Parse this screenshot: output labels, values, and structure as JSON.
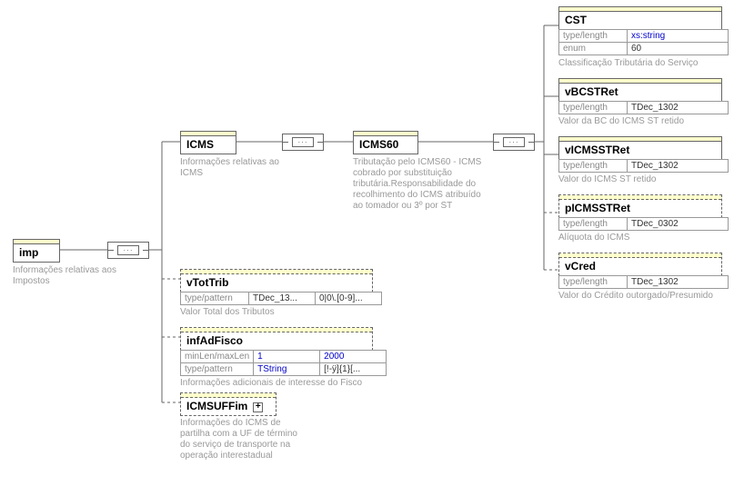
{
  "imp": {
    "label": "imp",
    "desc": "Informações relativas aos Impostos"
  },
  "icms": {
    "label": "ICMS",
    "desc": "Informações relativas ao ICMS"
  },
  "icms60": {
    "label": "ICMS60",
    "desc": "Tributação pelo ICMS60 - ICMS cobrado por substituição tributária.Responsabilidade do recolhimento do ICMS atribuído ao tomador ou 3º por ST"
  },
  "vTotTrib": {
    "label": "vTotTrib",
    "desc": "Valor Total dos Tributos",
    "prop_key": "type/pattern",
    "type": "TDec_13...",
    "pattern": "0|0\\.[0-9]..."
  },
  "infAdFisco": {
    "label": "infAdFisco",
    "desc": "Informações adicionais de interesse do Fisco",
    "row1_key": "minLen/maxLen",
    "min": "1",
    "max": "2000",
    "row2_key": "type/pattern",
    "type": "TString",
    "pattern": "[!-ÿ]{1}[..."
  },
  "icmsUfFim": {
    "label": "ICMSUFFim",
    "desc": "Informações do ICMS de partilha com a UF de término do serviço de transporte na operação interestadual"
  },
  "cst": {
    "label": "CST",
    "desc": "Classificação Tributária do Serviço",
    "row1_key": "type/length",
    "type": "xs:string",
    "row2_key": "enum",
    "enum": "60"
  },
  "vBCSTRet": {
    "label": "vBCSTRet",
    "desc": "Valor da BC do ICMS ST retido",
    "prop_key": "type/length",
    "type": "TDec_1302"
  },
  "vICMSSTRet": {
    "label": "vICMSSTRet",
    "desc": "Valor do ICMS ST retido",
    "prop_key": "type/length",
    "type": "TDec_1302"
  },
  "pICMSSTRet": {
    "label": "pICMSSTRet",
    "desc": "Alíquota do ICMS",
    "prop_key": "type/length",
    "type": "TDec_0302"
  },
  "vCred": {
    "label": "vCred",
    "desc": "Valor do Crédito outorgado/Presumido",
    "prop_key": "type/length",
    "type": "TDec_1302"
  }
}
